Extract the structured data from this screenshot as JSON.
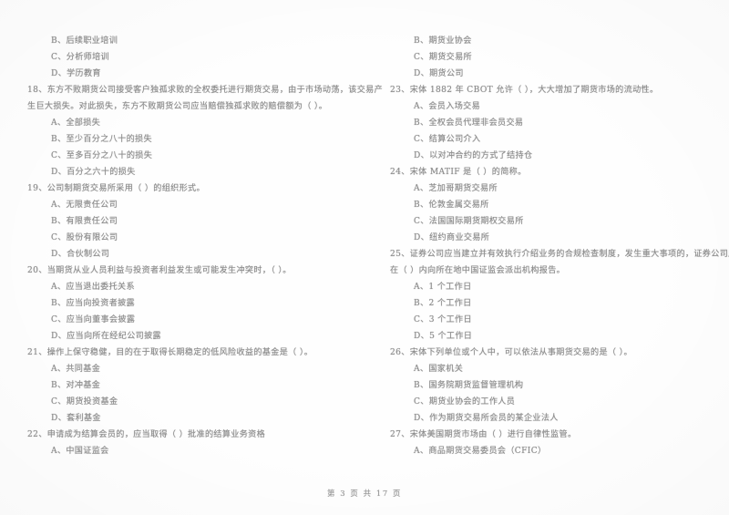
{
  "document": {
    "type": "scanned-exam-paper",
    "footer": "第 3 页  共 17 页",
    "page_number": "3",
    "total_pages": "17"
  },
  "left_column": {
    "blocks": [
      {
        "kind": "options_continued",
        "lines": [
          "B、后续职业培训",
          "C、分析师培训",
          "D、学历教育"
        ]
      },
      {
        "kind": "question",
        "stem_lines": [
          "18、东方不败期货公司接受客户独孤求败的全权委托进行期货交易，由于市场动荡，该交易产",
          "生巨大损失。对此损失，东方不败期货公司应当赔偿独孤求败的赔偿额为（      ）。"
        ],
        "options": [
          "A、全部损失",
          "B、至少百分之八十的损失",
          "C、至多百分之八十的损失",
          "D、百分之六十的损失"
        ]
      },
      {
        "kind": "question",
        "stem_lines": [
          "19、公司制期货交易所采用（      ）的组织形式。"
        ],
        "options": [
          "A、无限责任公司",
          "B、有限责任公司",
          "C、股份有限公司",
          "D、合伙制公司"
        ]
      },
      {
        "kind": "question",
        "stem_lines": [
          "20、当期货从业人员利益与投资者利益发生或可能发生冲突时，（      ）。"
        ],
        "options": [
          "A、应当退出委托关系",
          "B、应当向投资者披露",
          "C、应当向董事会披露",
          "D、应当向所在经纪公司披露"
        ]
      },
      {
        "kind": "question",
        "stem_lines": [
          "21、操作上保守稳健，目的在于取得长期稳定的低风险收益的基金是（      ）。"
        ],
        "options": [
          "A、共同基金",
          "B、对冲基金",
          "C、期货投资基金",
          "D、套利基金"
        ]
      },
      {
        "kind": "question",
        "stem_lines": [
          "22、申请成为结算会员的，应当取得（      ）批准的结算业务资格"
        ],
        "options": [
          "A、中国证监会"
        ]
      }
    ]
  },
  "right_column": {
    "blocks": [
      {
        "kind": "options_continued",
        "lines": [
          "B、期货业协会",
          "C、期货交易所",
          "D、期货公司"
        ]
      },
      {
        "kind": "question",
        "stem_lines": [
          "23、宋体 1882 年 CBOT 允许（      ），大大增加了期货市场的流动性。"
        ],
        "options": [
          "A、会员入场交易",
          "B、全权会员代理非会员交易",
          "C、结算公司介入",
          "D、以对冲合约的方式了结持仓"
        ]
      },
      {
        "kind": "question",
        "stem_lines": [
          "24、宋体 MATIF 是（      ）的简称。"
        ],
        "options": [
          "A、芝加哥期货交易所",
          "B、伦敦金属交易所",
          "C、法国国际期货期权交易所",
          "D、纽约商业交易所"
        ]
      },
      {
        "kind": "question",
        "stem_lines": [
          "25、证券公司应当建立并有效执行介绍业务的合规检查制度，发生重大事项的，证券公司应当",
          "在（      ）内向所在地中国证监会派出机构报告。"
        ],
        "options": [
          "A、1 个工作日",
          "B、2 个工作日",
          "C、3 个工作日",
          "D、5 个工作日"
        ]
      },
      {
        "kind": "question",
        "stem_lines": [
          "26、宋体下列单位或个人中，可以依法从事期货交易的是（      ）。"
        ],
        "options": [
          "A、国家机关",
          "B、国务院期货监督管理机构",
          "C、期货业协会的工作人员",
          "D、作为期货交易所会员的某企业法人"
        ]
      },
      {
        "kind": "question",
        "stem_lines": [
          "27、宋体美国期货市场由（      ）进行自律性监管。"
        ],
        "options": [
          "A、商品期货交易委员会（CFIC）"
        ]
      }
    ]
  }
}
